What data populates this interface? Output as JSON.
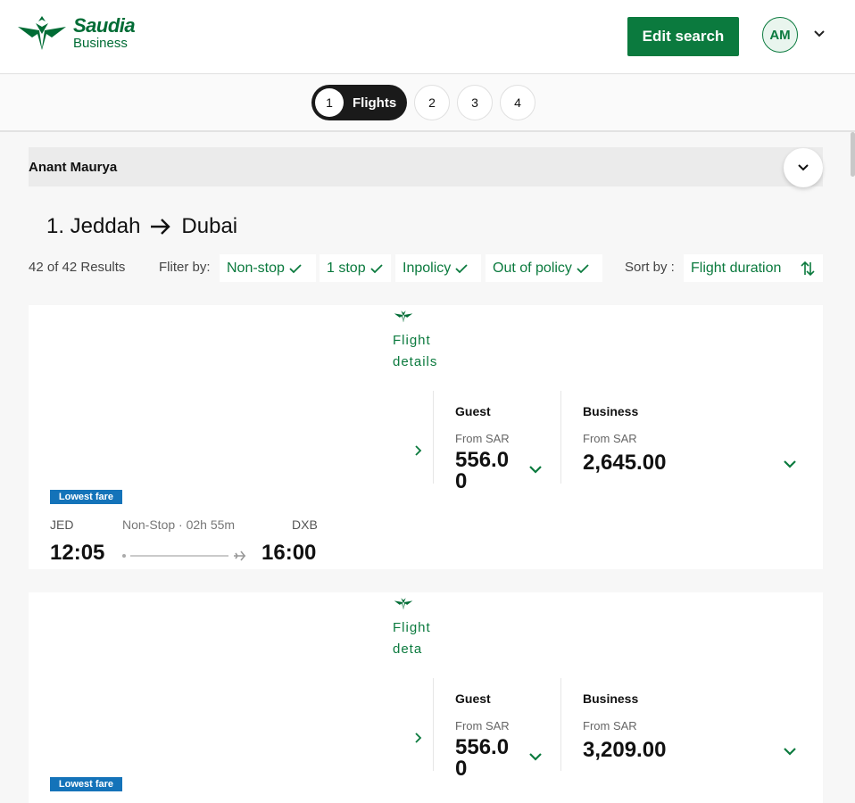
{
  "header": {
    "brand_name": "Saudia",
    "brand_sub": "Business",
    "edit_search_label": "Edit search",
    "avatar_initials": "AM"
  },
  "stepper": {
    "active": {
      "number": "1",
      "label": "Flights"
    },
    "steps": [
      "2",
      "3",
      "4"
    ]
  },
  "traveller": {
    "name": "Anant Maurya"
  },
  "route": {
    "prefix": "1. Jeddah",
    "destination": "Dubai"
  },
  "filters": {
    "results": "42 of 42 Results",
    "label": "Fliter by:",
    "chips": [
      "Non-stop",
      "1 stop",
      "Inpolicy",
      "Out of policy"
    ],
    "sort_label": "Sort by :",
    "sort_value": "Flight duration"
  },
  "colors": {
    "brand_green": "#0b7a3e",
    "badge_blue": "#1473b9"
  },
  "flights": [
    {
      "badge": "Lowest fare",
      "origin": "JED",
      "destination": "DXB",
      "summary": "Non-Stop · 02h 55m",
      "depart": "12:05",
      "arrive": "16:00",
      "details_label": "Flight details",
      "fares": [
        {
          "title": "Guest",
          "from": "From SAR",
          "price_l1": "556.0",
          "price_l2": "0"
        },
        {
          "title": "Business",
          "from": "From SAR",
          "price_l1": "2,645.00",
          "price_l2": ""
        }
      ]
    },
    {
      "badge": "Lowest fare",
      "details_label": "Flight deta",
      "fares": [
        {
          "title": "Guest",
          "from": "From SAR",
          "price_l1": "556.0",
          "price_l2": "0"
        },
        {
          "title": "Business",
          "from": "From SAR",
          "price_l1": "3,209.00",
          "price_l2": ""
        }
      ]
    }
  ],
  "icons": {
    "logo": "saudia-wing-logo-icon",
    "chevron_down": "chevron-down-icon",
    "chevron_right": "chevron-right-icon",
    "check": "check-icon",
    "arrow_right": "arrow-right-icon",
    "sort": "sort-arrows-icon",
    "plane": "plane-icon"
  }
}
